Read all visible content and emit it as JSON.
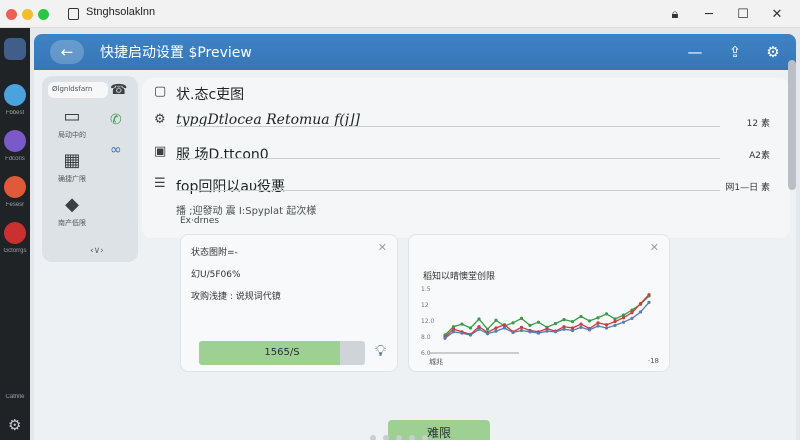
{
  "os_window": {
    "title": "Stnghsolaklnn",
    "controls": [
      "lock-icon",
      "minimize-icon",
      "maximize-icon",
      "close-icon"
    ]
  },
  "dock": {
    "items": [
      {
        "label": "",
        "icon": "apps-grid-icon",
        "color": "#5a9be0"
      },
      {
        "label": "Fbbest",
        "icon": "weather-icon",
        "color": "#4aa3df"
      },
      {
        "label": "Fdcoris",
        "icon": "media-icon",
        "color": "#7b59c9"
      },
      {
        "label": "Fesesr",
        "icon": "browser-icon",
        "color": "#e05a3a"
      },
      {
        "label": "Gctorrgs",
        "icon": "settings-app-icon",
        "color": "#c93030"
      }
    ],
    "bottom_label": "Cathlte"
  },
  "header": {
    "title": "快捷启动设置 $Preview",
    "back_label": "←",
    "icons": [
      "minimize-dash-icon",
      "share-icon",
      "gear-icon"
    ]
  },
  "nav": {
    "tab_label": "Ølgnldsfarn",
    "items": [
      {
        "label": "局动中的",
        "icon": "message-icon"
      },
      {
        "label": "确捷广限",
        "icon": "keyboard-icon"
      },
      {
        "label": "南产低限",
        "icon": "palette-icon"
      }
    ],
    "more_label": "‹∨›"
  },
  "rows": [
    {
      "text": "状.态c吏图",
      "count": ""
    },
    {
      "text": "typgDtlocea Retomua f(j⌋]",
      "count": "12 素"
    },
    {
      "text": "服 场D.ttcon0",
      "count": "A2素"
    },
    {
      "text": "fop回阳以aυ役悪",
      "count": "网1—日 素"
    }
  ],
  "sub_row": "播 ;迎發动 震 I:Spyplat 起次様",
  "section_label": "Ex·drnes",
  "stat_card": {
    "line1": "状态图附=-",
    "line2": "幻U/5F06%",
    "line3": "攻购浅捷 : 说规词代镜",
    "progress_label": "1565/S",
    "progress_value": 0.85
  },
  "chart_card": {
    "title": "稻知以晴懊堂创限",
    "footer_left": "城兆",
    "footer_right": "·18"
  },
  "chart_data": {
    "type": "line",
    "x": [
      0,
      1,
      2,
      3,
      4,
      5,
      6,
      7,
      8,
      9,
      10,
      11,
      12,
      13,
      14,
      15,
      16,
      17,
      18,
      19,
      20,
      21,
      22,
      23,
      24
    ],
    "series": [
      {
        "color": "#3a9a4a",
        "values": [
          8.5,
          9.8,
          10.2,
          9.6,
          11.0,
          9.4,
          10.8,
          9.9,
          10.4,
          11.1,
          10.0,
          10.5,
          9.7,
          10.3,
          10.9,
          10.6,
          11.4,
          10.7,
          11.2,
          11.8,
          11.0,
          11.6,
          12.4,
          13.3,
          14.6
        ]
      },
      {
        "color": "#d03a3a",
        "values": [
          8.2,
          9.4,
          9.0,
          8.6,
          9.8,
          8.9,
          9.6,
          10.1,
          9.0,
          9.7,
          9.2,
          9.0,
          9.5,
          9.1,
          9.8,
          9.6,
          10.2,
          9.5,
          10.4,
          10.1,
          10.6,
          11.2,
          12.0,
          13.4,
          14.8
        ]
      },
      {
        "color": "#5a7ab0",
        "values": [
          8.0,
          9.0,
          8.8,
          8.5,
          9.4,
          8.7,
          9.1,
          9.6,
          8.9,
          9.2,
          9.0,
          8.8,
          9.1,
          9.0,
          9.4,
          9.2,
          9.7,
          9.3,
          9.9,
          9.6,
          10.0,
          10.5,
          11.1,
          12.1,
          13.6
        ]
      }
    ],
    "ylim": [
      6,
      16
    ],
    "tick_labels": [
      "1.5",
      "12",
      "12.0",
      "8.0",
      "6.0"
    ]
  },
  "confirm_label": "难限",
  "pager_dots": 5
}
